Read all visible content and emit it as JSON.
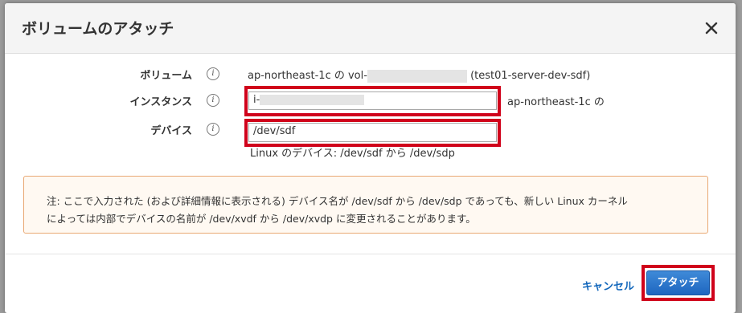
{
  "dialog": {
    "title": "ボリュームのアタッチ",
    "close_icon": "close-icon"
  },
  "form": {
    "volume": {
      "label": "ボリューム",
      "value_prefix": "ap-northeast-1c の vol-",
      "value_suffix": "(test01-server-dev-sdf)"
    },
    "instance": {
      "label": "インスタンス",
      "value": "i-",
      "az_text": "ap-northeast-1c の"
    },
    "device": {
      "label": "デバイス",
      "value": "/dev/sdf",
      "hint": "Linux のデバイス: /dev/sdf から /dev/sdp"
    },
    "info_icon": "info-icon"
  },
  "note": {
    "line1": "注: ここで入力された (および詳細情報に表示される) デバイス名が /dev/sdf から /dev/sdp であっても、新しい Linux カーネル",
    "line2": "によっては内部でデバイスの名前が /dev/xvdf から /dev/xvdp に変更されることがあります。"
  },
  "footer": {
    "cancel_label": "キャンセル",
    "attach_label": "アタッチ"
  },
  "colors": {
    "highlight": "#d0021b",
    "primary_button": "#1e66c0",
    "link": "#1166bb",
    "note_border": "#e9a873"
  }
}
